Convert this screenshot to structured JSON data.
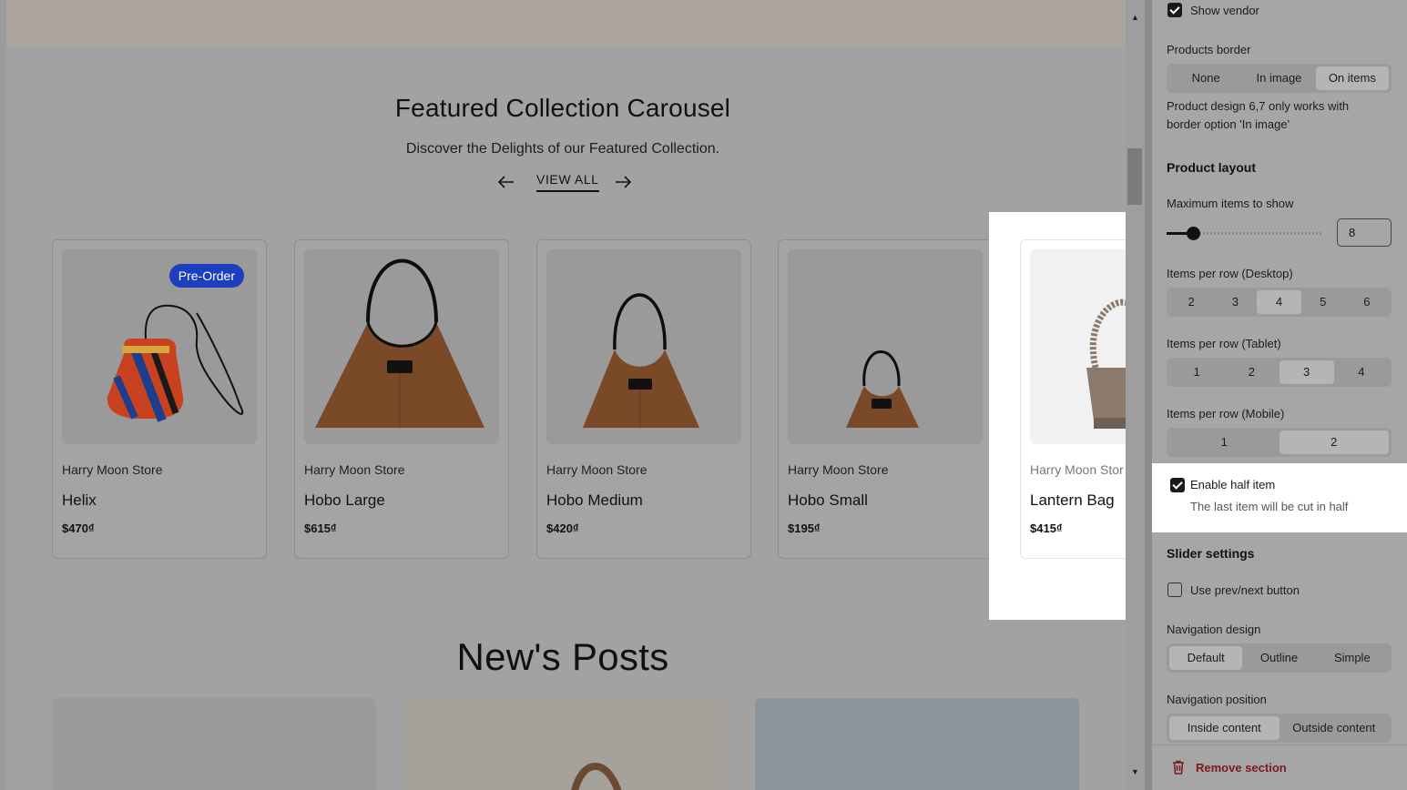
{
  "preview": {
    "featured": {
      "title": "Featured Collection Carousel",
      "subtitle": "Discover the Delights of our Featured Collection.",
      "view_all": "VIEW ALL",
      "prev_icon": "arrow-left-icon",
      "next_icon": "arrow-right-icon"
    },
    "products": [
      {
        "vendor": "Harry Moon Store",
        "name": "Helix",
        "price": "$470₫",
        "badge": "Pre-Order"
      },
      {
        "vendor": "Harry Moon Store",
        "name": "Hobo Large",
        "price": "$615₫"
      },
      {
        "vendor": "Harry Moon Store",
        "name": "Hobo Medium",
        "price": "$420₫"
      },
      {
        "vendor": "Harry Moon Store",
        "name": "Hobo Small",
        "price": "$195₫"
      },
      {
        "vendor": "Harry Moon Stor",
        "name": "Lantern Bag",
        "price": "$415₫"
      }
    ],
    "posts": {
      "title": "New's Posts"
    }
  },
  "panel": {
    "show_vendor": {
      "label": "Show vendor",
      "checked": true
    },
    "products_border": {
      "label": "Products border",
      "options": [
        "None",
        "In image",
        "On items"
      ],
      "selected": "On items",
      "note_line1": "Product design 6,7 only works with",
      "note_line2": "border option 'In image'"
    },
    "product_layout": {
      "heading": "Product layout",
      "max_items_label": "Maximum items to show",
      "max_items_value": "8",
      "desktop": {
        "label": "Items per row (Desktop)",
        "options": [
          "2",
          "3",
          "4",
          "5",
          "6"
        ],
        "selected": "4"
      },
      "tablet": {
        "label": "Items per row (Tablet)",
        "options": [
          "1",
          "2",
          "3",
          "4"
        ],
        "selected": "3"
      },
      "mobile": {
        "label": "Items per row (Mobile)",
        "options": [
          "1",
          "2"
        ],
        "selected": "2"
      },
      "half_item": {
        "label": "Enable half item",
        "hint": "The last item will be cut in half",
        "checked": true
      }
    },
    "slider_settings": {
      "heading": "Slider settings",
      "prev_next": {
        "label": "Use prev/next button",
        "checked": false
      },
      "nav_design": {
        "label": "Navigation design",
        "options": [
          "Default",
          "Outline",
          "Simple"
        ],
        "selected": "Default"
      },
      "nav_position": {
        "label": "Navigation position",
        "options": [
          "Inside content",
          "Outside content"
        ],
        "selected": "Inside content"
      }
    },
    "remove_section": {
      "label": "Remove section",
      "icon": "trash-icon"
    }
  },
  "colors": {
    "badge": "#1b3fbf",
    "remove": "#7a1b1b"
  }
}
